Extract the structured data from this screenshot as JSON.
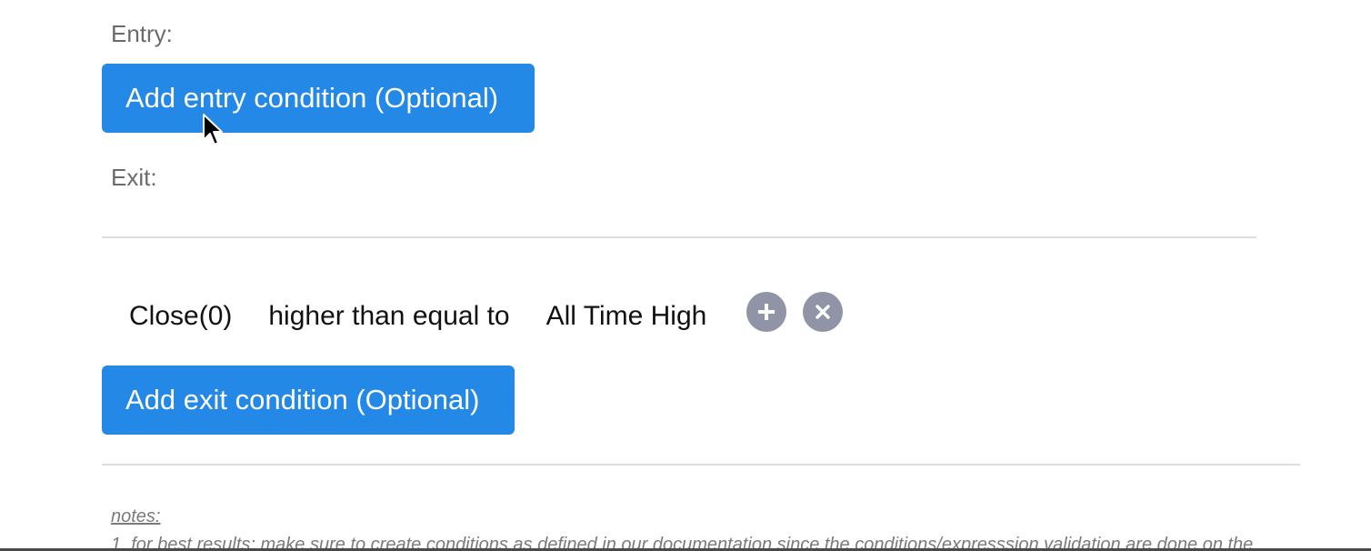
{
  "entry": {
    "label": "Entry:",
    "add_button": "Add entry condition (Optional)"
  },
  "exit": {
    "label": "Exit:",
    "condition": {
      "left": "Close(0)",
      "operator": "higher than equal to",
      "right": "All Time High"
    },
    "add_button": "Add exit condition (Optional)"
  },
  "notes": {
    "title": "notes:",
    "line1": "1. for best results: make sure to create conditions as defined in our documentation since the conditions/expresssion validation are done on the"
  },
  "colors": {
    "primary": "#2488e6",
    "icon_button": "#9094a6"
  },
  "icons": {
    "add": "plus-icon",
    "remove": "close-icon",
    "pointer": "mouse-cursor-icon"
  }
}
